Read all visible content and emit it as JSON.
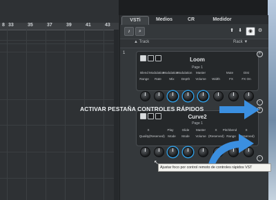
{
  "ruler": {
    "marks": [
      "13",
      "25",
      "37",
      "49",
      "61",
      "73",
      "85",
      "97",
      "109",
      "121",
      "133",
      "145",
      "157",
      "169"
    ],
    "labels": [
      "8",
      "33",
      "39",
      "41",
      "43"
    ]
  },
  "tabs": {
    "vsti": "VSTi",
    "medios": "Medios",
    "cr": "CR",
    "medidor": "Medidor"
  },
  "toolbar": {
    "search_icon": "search-icon",
    "vst_icon": "piano-icon"
  },
  "trackrow": {
    "track": "Track",
    "rack": "Rack"
  },
  "slot": {
    "number": "1"
  },
  "module1": {
    "name": "Loom",
    "page": "Page 1",
    "top_labels": [
      "Blend",
      "Modulation",
      "Modulation",
      "Modulation",
      "Master",
      "",
      "Mute",
      "Dist"
    ],
    "bottom_labels": [
      "Range",
      "Rate",
      "Mix",
      "Depth",
      "Volume",
      "Width",
      "FX",
      "FX On"
    ]
  },
  "module2": {
    "name": "Curve2",
    "page": "Page 1",
    "top_labels": [
      "X",
      "Play",
      "Glide",
      "Master",
      "X",
      "Pitchbend",
      "X"
    ],
    "bottom_labels": [
      "Quality",
      "(Reserved)",
      "Mode",
      "Mode",
      "Volume",
      "(Reserved)",
      "Range",
      "(Reserved)"
    ]
  },
  "overlay": {
    "text": "ACTIVAR PESTAÑA CONTROLES RÁPIDOS"
  },
  "tooltip": {
    "text": "Ajustar foco por control remoto de controles rápidos VST"
  },
  "colors": {
    "accent_blue": "#2f9be0",
    "arrow_blue": "#3b8fe0"
  }
}
